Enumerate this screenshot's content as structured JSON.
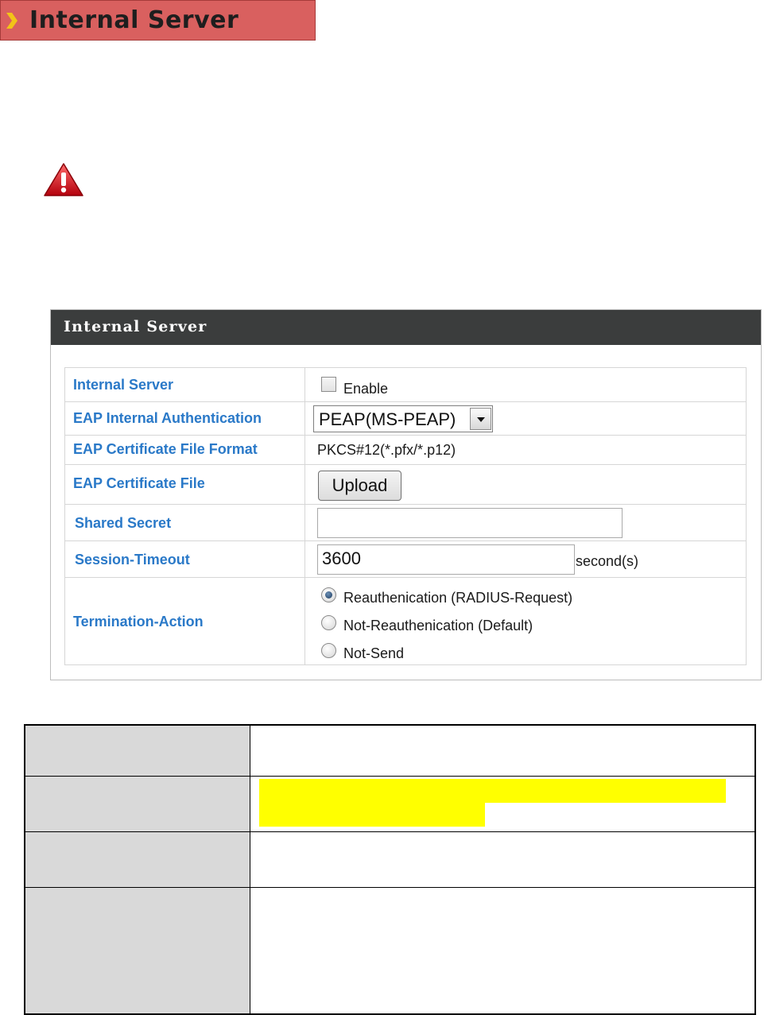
{
  "heading": {
    "title": "Internal Server"
  },
  "panel": {
    "title": "Internal Server",
    "rows": {
      "internal_server": {
        "label": "Internal Server",
        "checkbox_label": "Enable",
        "checked": false
      },
      "eap_auth": {
        "label": "EAP Internal Authentication",
        "selected": "PEAP(MS-PEAP)"
      },
      "cert_format": {
        "label": "EAP Certificate File Format",
        "value": "PKCS#12(*.pfx/*.p12)"
      },
      "cert_file": {
        "label": "EAP Certificate File",
        "button": "Upload"
      },
      "shared_secret": {
        "label": "Shared Secret",
        "value": ""
      },
      "session_timeout": {
        "label": "Session-Timeout",
        "value": "3600",
        "unit": "second(s)"
      },
      "termination": {
        "label": "Termination-Action",
        "options": [
          {
            "label": "Reauthenication (RADIUS-Request)",
            "selected": true
          },
          {
            "label": "Not-Reauthenication (Default)",
            "selected": false
          },
          {
            "label": "Not-Send",
            "selected": false
          }
        ]
      }
    }
  },
  "colors": {
    "banner": "#d9605f",
    "panel_header": "#3b3d3d",
    "label_text": "#2a79c8",
    "highlight": "#ffff00",
    "desc_label_bg": "#d9d9d9"
  },
  "icons": {
    "heading": "chevron-right-icon",
    "warning": "warning-icon"
  }
}
